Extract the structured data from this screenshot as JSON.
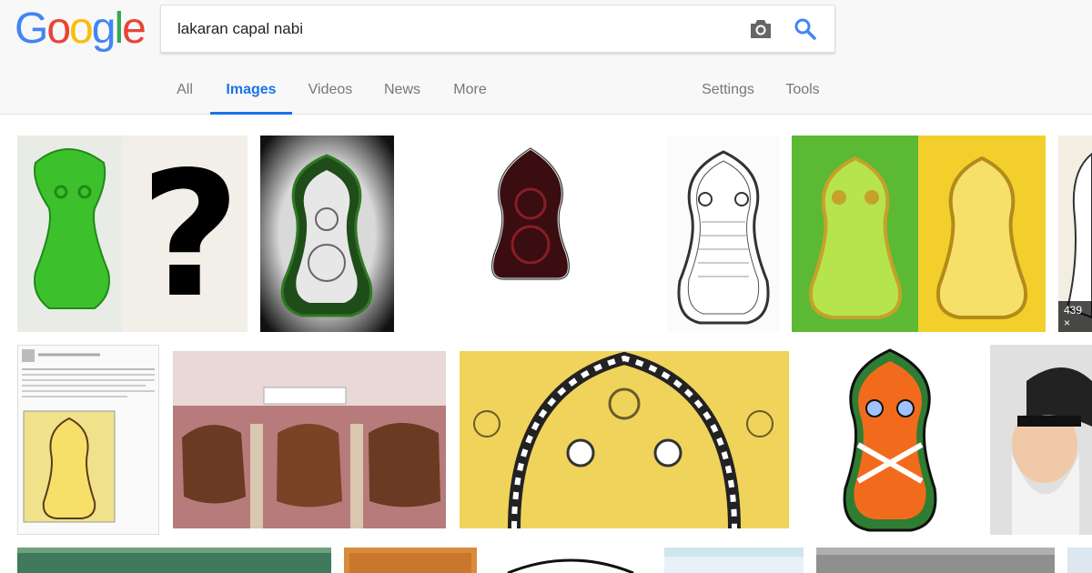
{
  "logo": {
    "text": "Google"
  },
  "search": {
    "value": "lakaran capal nabi"
  },
  "icons": {
    "camera": "camera-icon",
    "search": "search-icon"
  },
  "tabs": [
    {
      "label": "All"
    },
    {
      "label": "Images"
    },
    {
      "label": "Videos"
    },
    {
      "label": "News"
    },
    {
      "label": "More"
    }
  ],
  "right_tabs": [
    {
      "label": "Settings"
    },
    {
      "label": "Tools"
    }
  ],
  "results": {
    "count_badge": "439 ×"
  },
  "colors": {
    "accent": "#1a73e8",
    "logo_blue": "#4285f4",
    "logo_red": "#ea4335",
    "logo_yellow": "#fbbc05",
    "logo_green": "#34a853"
  }
}
